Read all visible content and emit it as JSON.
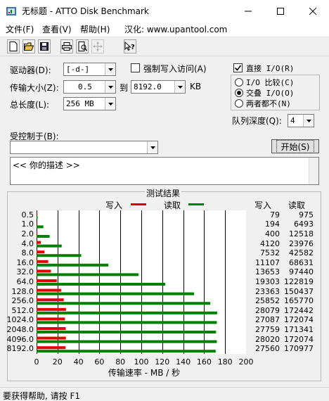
{
  "window": {
    "title": "无标题 - ATTO Disk Benchmark"
  },
  "menu": [
    {
      "label": "文件(F)"
    },
    {
      "label": "查看(V)"
    },
    {
      "label": "帮助(H)"
    },
    {
      "label": "汉化: www.upantool.com"
    }
  ],
  "toolbar": {
    "icons": [
      "new-file-icon",
      "open-folder-icon",
      "save-icon",
      "print-icon",
      "print-preview-icon",
      "move-icon",
      "help-pointer-icon"
    ]
  },
  "form": {
    "drive_label": "驱动器(D):",
    "drive_value": "[-d-]",
    "force_write_label": "强制写入访问(A)",
    "transfer_label": "传输大小(Z):",
    "transfer_from": "0.5",
    "to_label": "到",
    "transfer_to": "8192.0",
    "kb_label": "KB",
    "total_label": "总长度(L):",
    "total_value": "256 MB",
    "direct_io_label": "直接 I/O(R)",
    "direct_io_checked": true,
    "radio_options": [
      {
        "label": "I/O 比较(C)",
        "selected": false
      },
      {
        "label": "交叠 I/O(O)",
        "selected": true
      },
      {
        "label": "两者都不(N)",
        "selected": false
      }
    ],
    "queue_label": "队列深度(Q):",
    "queue_value": "4",
    "controlled_label": "受控制于(B):",
    "controlled_value": "",
    "start_label": "开始(S)",
    "description": "<<  你的描述  >>"
  },
  "results": {
    "title": "测试结果",
    "legend_write": "写入",
    "legend_read": "读取",
    "col_write": "写入",
    "col_read": "读取",
    "colors": {
      "write": "#e00000",
      "read": "#008000"
    }
  },
  "chart_data": {
    "type": "bar",
    "title": "测试结果",
    "xlabel": "传输速率 - MB / 秒",
    "xlim": [
      0,
      200
    ],
    "xticks": [
      "0",
      "20",
      "40",
      "60",
      "80",
      "100",
      "120",
      "140",
      "160",
      "180",
      "200"
    ],
    "categories": [
      "0.5",
      "1.0",
      "2.0",
      "4.0",
      "8.0",
      "16.0",
      "32.0",
      "64.0",
      "128.0",
      "256.0",
      "512.0",
      "1024.0",
      "2048.0",
      "4096.0",
      "8192.0"
    ],
    "series": [
      {
        "name": "写入",
        "values": [
          0.1,
          0.2,
          0.4,
          4.1,
          7.5,
          11.1,
          13.7,
          19.3,
          23.4,
          25.9,
          28.1,
          27.1,
          27.8,
          28.0,
          27.6
        ]
      },
      {
        "name": "读取",
        "values": [
          1.0,
          6.5,
          12.5,
          24.0,
          42.6,
          68.6,
          97.4,
          122.8,
          150.4,
          165.8,
          172.4,
          172.1,
          171.3,
          172.1,
          171.0
        ]
      }
    ],
    "write_text": [
      "79",
      "194",
      "400",
      "4120",
      "7532",
      "11107",
      "13653",
      "19303",
      "23363",
      "25852",
      "28079",
      "27087",
      "27759",
      "28020",
      "27560"
    ],
    "read_text": [
      "975",
      "6493",
      "12518",
      "23976",
      "42582",
      "68631",
      "97440",
      "122819",
      "150437",
      "165770",
      "172442",
      "172074",
      "171341",
      "172074",
      "170977"
    ]
  },
  "status": {
    "text": "要获得帮助, 请按 F1"
  }
}
